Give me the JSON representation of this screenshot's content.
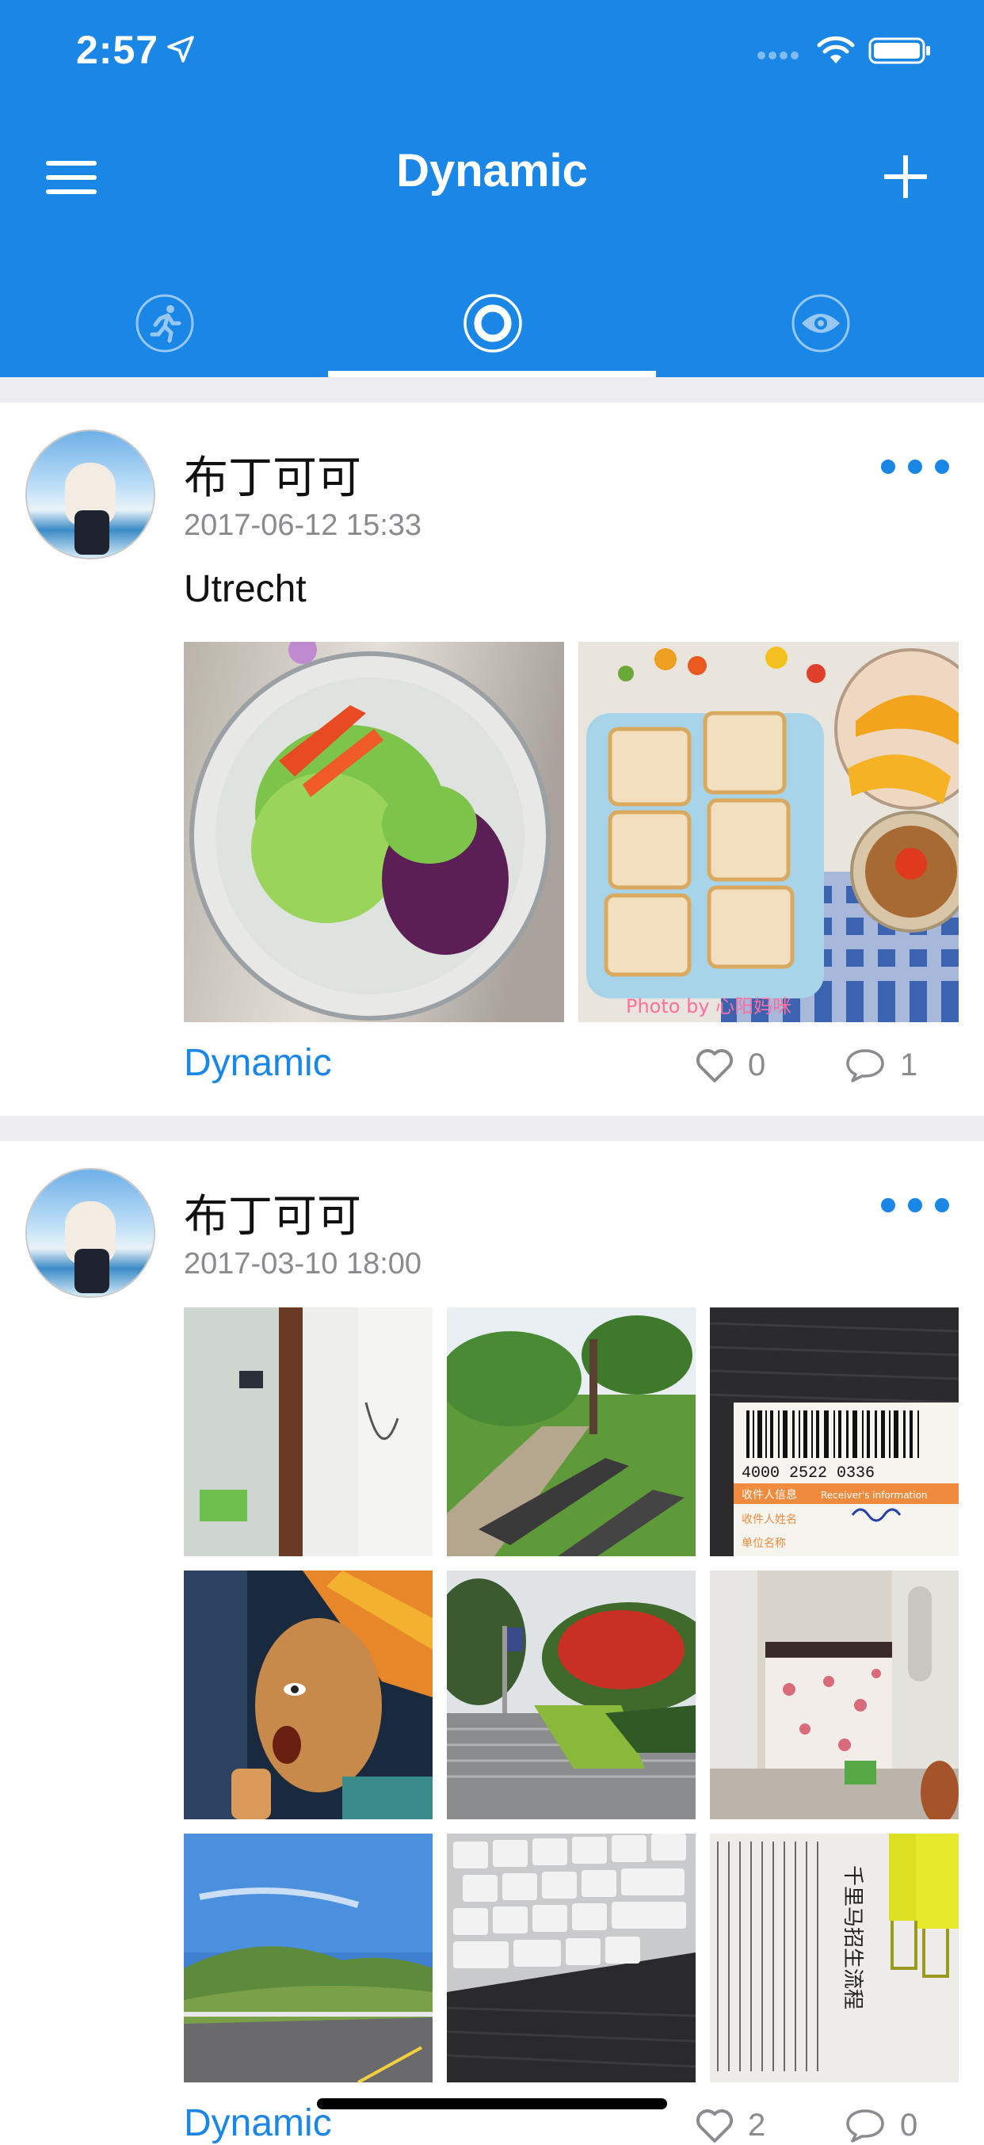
{
  "status_bar": {
    "time": "2:57"
  },
  "nav": {
    "title": "Dynamic"
  },
  "tabs": [
    {
      "icon": "running-person-icon",
      "active": false
    },
    {
      "icon": "circle-ring-icon",
      "active": true
    },
    {
      "icon": "eye-icon",
      "active": false
    }
  ],
  "colors": {
    "accent": "#1a86e6",
    "separator": "#ececf1",
    "muted": "#8a8a8f"
  },
  "posts": [
    {
      "username": "布丁可可",
      "datetime": "2017-06-12 15:33",
      "text": "Utrecht",
      "category": "Dynamic",
      "likes": "0",
      "comments": "1",
      "photo_watermark": "Photo by 心阳妈咪",
      "photos": [
        "salad-bowl-photo",
        "toast-breakfast-photo"
      ]
    },
    {
      "username": "布丁可可",
      "datetime": "2017-03-10 18:00",
      "category": "Dynamic",
      "likes": "2",
      "comments": "0",
      "photos": [
        "bathroom-doorway-photo",
        "park-bench-photo",
        "shipping-label-barcode-photo",
        "statue-face-painting-photo",
        "flowering-tree-steps-photo",
        "bedroom-photo",
        "mountain-road-photo",
        "keyboard-photo",
        "recruitment-document-photo"
      ],
      "photo_texts": {
        "barcode_number": "4000 2522 0336",
        "label_header": "收件人信息",
        "label_header_en": "Receiver's information",
        "label_name_field": "收件人姓名",
        "label_company_field": "单位名称",
        "document_title": "千里马招生流程"
      }
    }
  ]
}
